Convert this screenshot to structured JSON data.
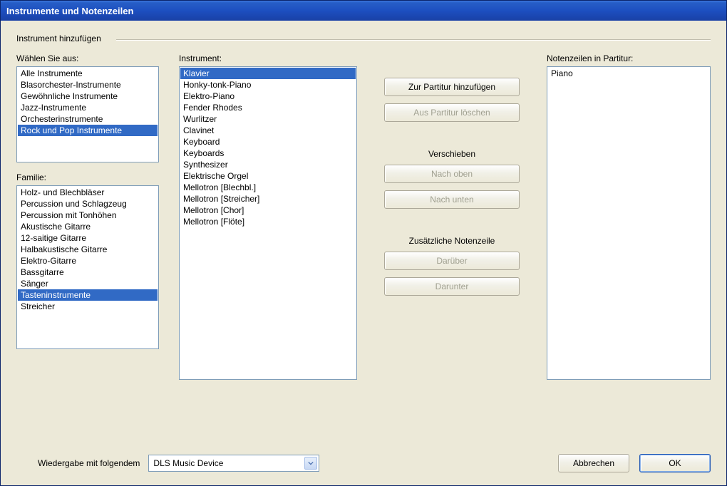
{
  "window": {
    "title": "Instrumente und Notenzeilen"
  },
  "fieldset": {
    "label": "Instrument hinzufügen"
  },
  "labels": {
    "choose": "Wählen Sie aus:",
    "family": "Familie:",
    "instrument": "Instrument:",
    "staves": "Notenzeilen in Partitur:"
  },
  "chooseList": {
    "items": [
      "Alle Instrumente",
      "Blasorchester-Instrumente",
      "Gewöhnliche Instrumente",
      "Jazz-Instrumente",
      "Orchesterinstrumente",
      "Rock und Pop Instrumente"
    ],
    "selectedIndex": 5
  },
  "familyList": {
    "items": [
      "Holz- und Blechbläser",
      "Percussion und Schlagzeug",
      "Percussion mit Tonhöhen",
      "Akustische Gitarre",
      "12-saitige Gitarre",
      "Halbakustische Gitarre",
      "Elektro-Gitarre",
      "Bassgitarre",
      "Sänger",
      "Tasteninstrumente",
      "Streicher"
    ],
    "selectedIndex": 9
  },
  "instrumentList": {
    "items": [
      "Klavier",
      "Honky-tonk-Piano",
      "Elektro-Piano",
      "Fender Rhodes",
      "Wurlitzer",
      "Clavinet",
      "Keyboard",
      "Keyboards",
      "Synthesizer",
      "Elektrische Orgel",
      "Mellotron [Blechbl.]",
      "Mellotron [Streicher]",
      "Mellotron [Chor]",
      "Mellotron [Flöte]"
    ],
    "selectedIndex": 0
  },
  "stavesList": {
    "items": [
      "Piano"
    ],
    "selectedIndex": -1
  },
  "buttons": {
    "addToScore": "Zur Partitur hinzufügen",
    "removeFromScore": "Aus Partitur löschen",
    "moveLabel": "Verschieben",
    "moveUp": "Nach oben",
    "moveDown": "Nach unten",
    "extraStaffLabel": "Zusätzliche Notenzeile",
    "above": "Darüber",
    "below": "Darunter",
    "cancel": "Abbrechen",
    "ok": "OK"
  },
  "playback": {
    "label": "Wiedergabe mit folgendem",
    "value": "DLS Music Device"
  }
}
